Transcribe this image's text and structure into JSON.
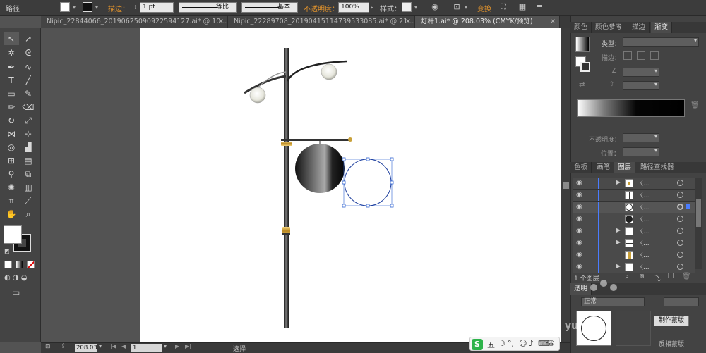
{
  "control_bar": {
    "object_type": "路径",
    "stroke_label": "描边：",
    "stroke_weight": "1 pt",
    "profile_uniform": "等比",
    "profile_basic": "基本",
    "opacity_label": "不透明度：",
    "opacity_value": "100%",
    "style_label": "样式：",
    "transform_label": "变换"
  },
  "tabs": [
    {
      "label": "Nipic_22844066_20190625090922594127.ai* @ 10...",
      "close": "×"
    },
    {
      "label": "Nipic_22289708_20190415114739533085.ai* @ 21...",
      "close": "×"
    },
    {
      "label": "灯杆1.ai* @ 208.03% (CMYK/预览)",
      "close": "×"
    }
  ],
  "status": {
    "zoom": "208.03",
    "page": "1",
    "tool_name": "选择"
  },
  "gradient_panel": {
    "tabs": [
      "颜色",
      "颜色参考",
      "描边",
      "渐变"
    ],
    "type_label": "类型：",
    "stroke_label": "描边：",
    "opacity_label": "不透明度：",
    "position_label": "位置："
  },
  "layers_panel": {
    "tabs": [
      "色板",
      "画笔",
      "图层",
      "路径查找器"
    ],
    "rows": [
      {
        "name": "〈...",
        "expand": "▶"
      },
      {
        "name": "〈...",
        "expand": ""
      },
      {
        "name": "〈...",
        "expand": ""
      },
      {
        "name": "〈...",
        "expand": ""
      },
      {
        "name": "〈...",
        "expand": "▶"
      },
      {
        "name": "〈...",
        "expand": "▶"
      },
      {
        "name": "〈...",
        "expand": ""
      },
      {
        "name": "〈...",
        "expand": "▶"
      }
    ],
    "count_label": "1 个图层"
  },
  "transparency_panel": {
    "tab": "透明",
    "mode": "正常",
    "make_mask": "制作蒙版",
    "invert_mask": "反相蒙版",
    "watermark": "yun.ba"
  },
  "colors": {
    "accent_orange": "#e0922c",
    "layer_blue": "#4a7cff",
    "selection_blue": "#2a5fd0",
    "gold": "#c9a13a"
  },
  "ime": {
    "logo": "S",
    "mode": "五"
  }
}
